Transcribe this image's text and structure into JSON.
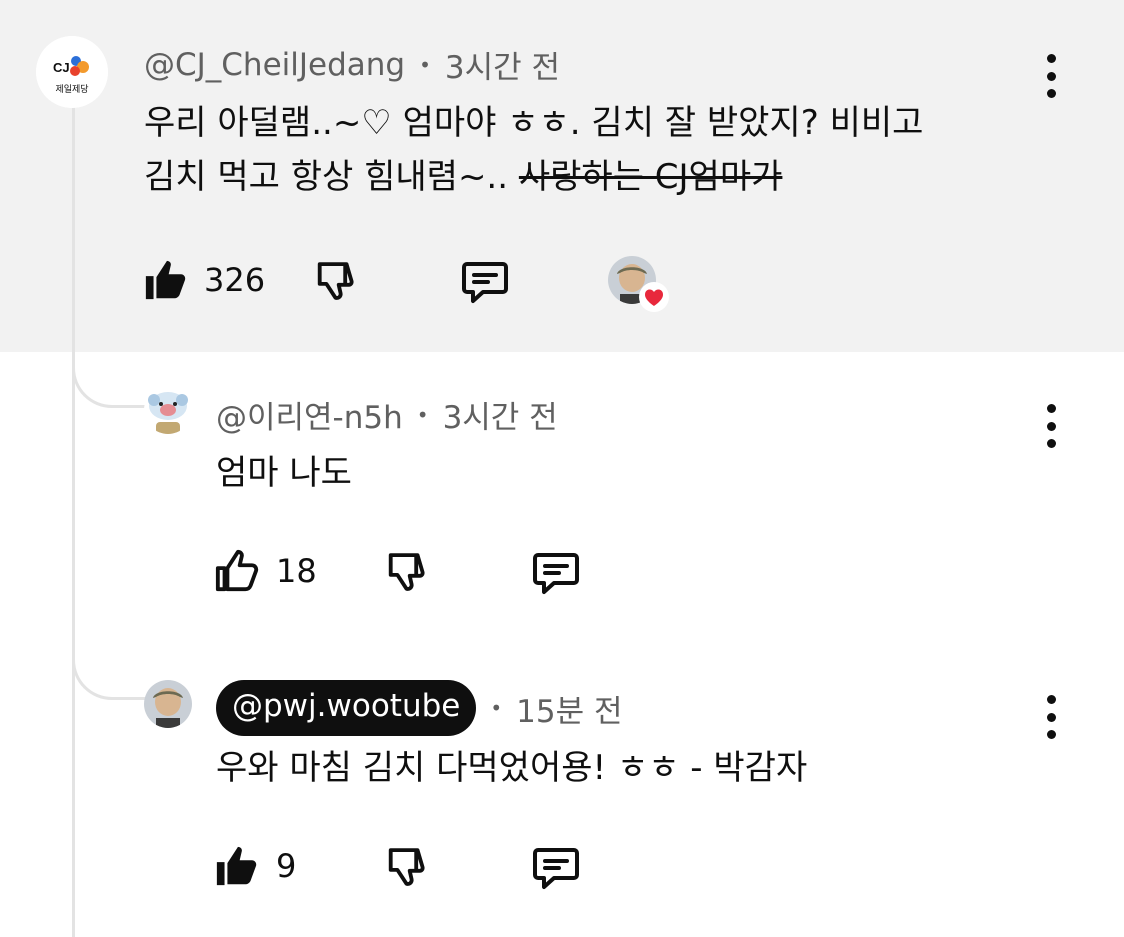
{
  "colors": {
    "highlight_bg": "#f2f2f2",
    "text": "#0f0f0f",
    "meta": "#606060",
    "heart": "#e8283c",
    "cj_orange": "#f39a2d",
    "cj_red": "#e8412c",
    "cj_blue": "#2b6fd8"
  },
  "comments": [
    {
      "avatar_label_top": "CJ",
      "avatar_label_bottom": "제일제당",
      "handle": "@CJ_CheilJedang",
      "time": "3시간 전",
      "line1": "우리 아덜램..~♡ 엄마야 ㅎㅎ. 김치 잘 받았지? 비비고",
      "line2_plain": "김치 먹고 항상 힘내렴~.. ",
      "line2_strike": "사랑하는 CJ엄마가",
      "likes": "326",
      "liked": true,
      "creator_heart": true
    },
    {
      "handle": "@이리연-n5h",
      "time": "3시간 전",
      "text": "엄마 나도",
      "likes": "18",
      "liked": false
    },
    {
      "handle": "@pwj.wootube",
      "handle_is_creator": true,
      "time": "15분 전",
      "text": "우와 마침 김치 다먹었어용! ㅎㅎ - 박감자",
      "likes": "9",
      "liked": true
    }
  ],
  "icons": {
    "like_filled": "thumbs-up-filled-icon",
    "like_outline": "thumbs-up-outline-icon",
    "dislike": "thumbs-down-icon",
    "reply": "reply-comment-icon",
    "more": "more-vertical-icon",
    "heart": "creator-heart-icon"
  }
}
